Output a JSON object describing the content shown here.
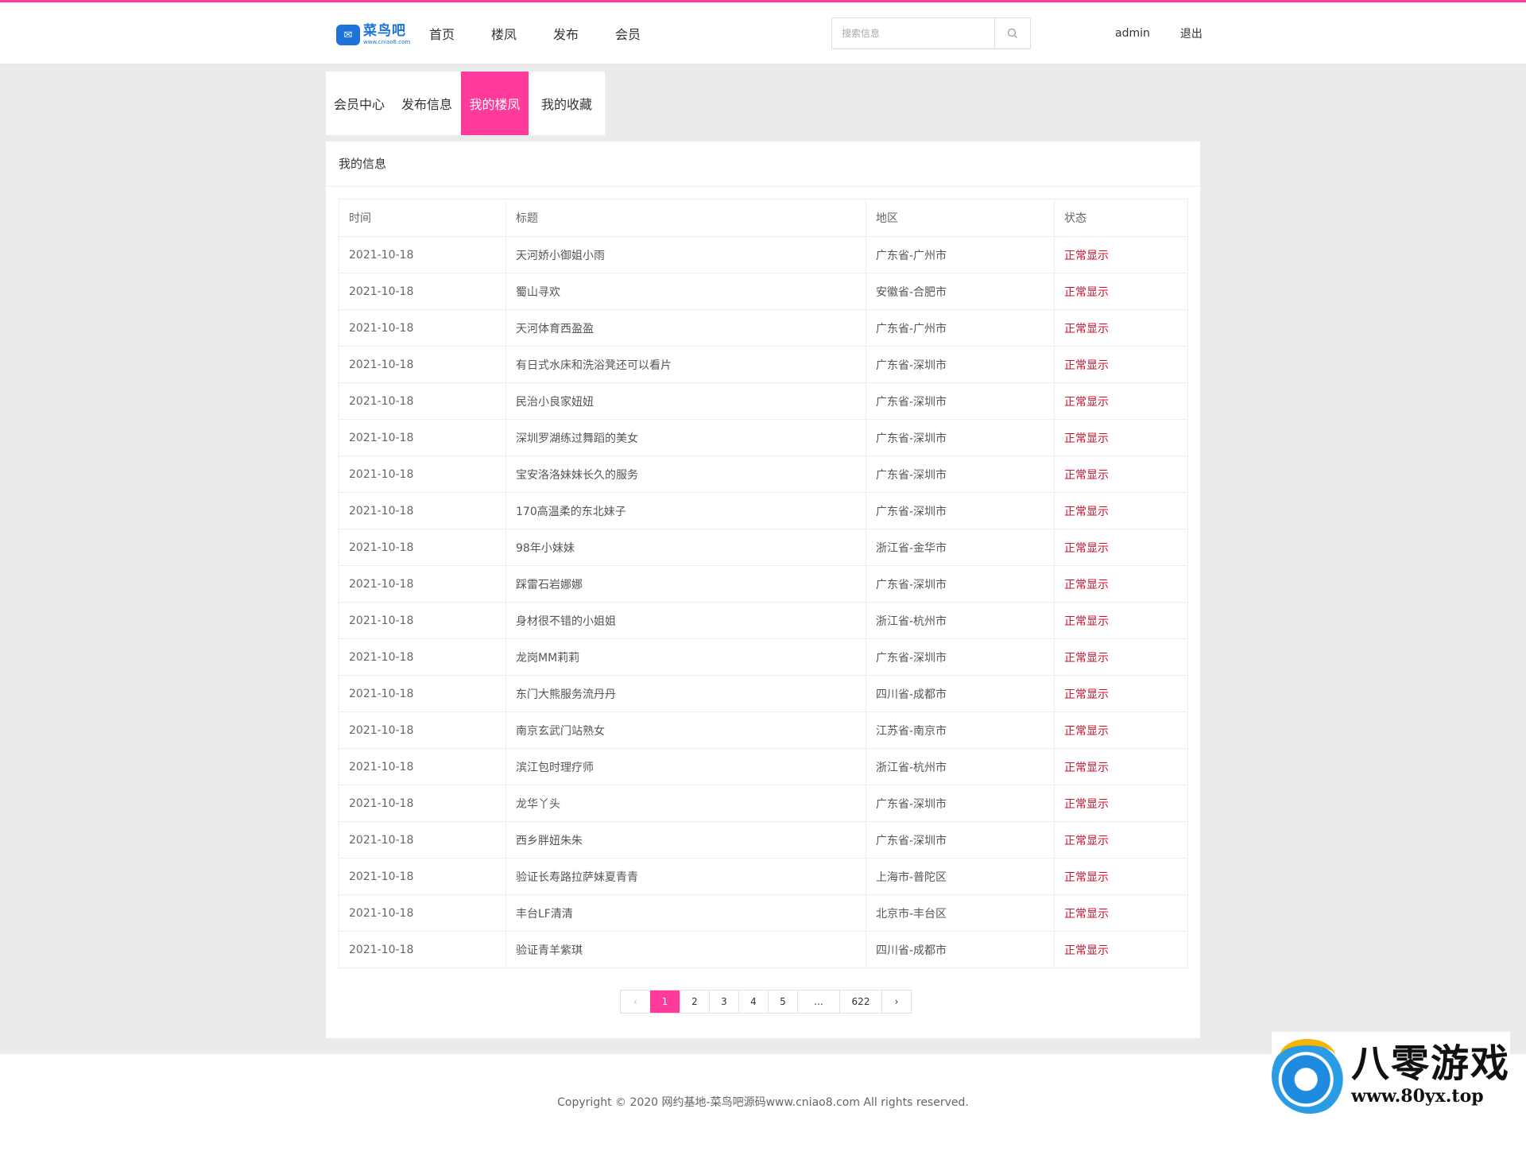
{
  "colors": {
    "accent": "#ff3a9a",
    "status": "#d0112b",
    "logo": "#1e73d9"
  },
  "header": {
    "logo_text": "菜鸟吧",
    "logo_url": "www.cniao8.com",
    "nav": [
      "首页",
      "楼凤",
      "发布",
      "会员"
    ],
    "search_placeholder": "搜索信息",
    "username": "admin",
    "logout": "退出"
  },
  "tabs": [
    {
      "label": "会员中心",
      "active": false
    },
    {
      "label": "发布信息",
      "active": false
    },
    {
      "label": "我的楼凤",
      "active": true
    },
    {
      "label": "我的收藏",
      "active": false
    }
  ],
  "panel": {
    "title": "我的信息",
    "columns": [
      "时间",
      "标题",
      "地区",
      "状态"
    ],
    "rows": [
      [
        "2021-10-18",
        "天河娇小御姐小雨",
        "广东省-广州市",
        "正常显示"
      ],
      [
        "2021-10-18",
        "蜀山寻欢",
        "安徽省-合肥市",
        "正常显示"
      ],
      [
        "2021-10-18",
        "天河体育西盈盈",
        "广东省-广州市",
        "正常显示"
      ],
      [
        "2021-10-18",
        "有日式水床和洗浴凳还可以看片",
        "广东省-深圳市",
        "正常显示"
      ],
      [
        "2021-10-18",
        "民治小良家妞妞",
        "广东省-深圳市",
        "正常显示"
      ],
      [
        "2021-10-18",
        "深圳罗湖练过舞蹈的美女",
        "广东省-深圳市",
        "正常显示"
      ],
      [
        "2021-10-18",
        "宝安洛洛妹妹长久的服务",
        "广东省-深圳市",
        "正常显示"
      ],
      [
        "2021-10-18",
        "170高温柔的东北妹子",
        "广东省-深圳市",
        "正常显示"
      ],
      [
        "2021-10-18",
        "98年小妹妹",
        "浙江省-金华市",
        "正常显示"
      ],
      [
        "2021-10-18",
        "踩雷石岩娜娜",
        "广东省-深圳市",
        "正常显示"
      ],
      [
        "2021-10-18",
        "身材很不错的小姐姐",
        "浙江省-杭州市",
        "正常显示"
      ],
      [
        "2021-10-18",
        "龙岗MM莉莉",
        "广东省-深圳市",
        "正常显示"
      ],
      [
        "2021-10-18",
        "东门大熊服务流丹丹",
        "四川省-成都市",
        "正常显示"
      ],
      [
        "2021-10-18",
        "南京玄武门站熟女",
        "江苏省-南京市",
        "正常显示"
      ],
      [
        "2021-10-18",
        "滨江包时理疗师",
        "浙江省-杭州市",
        "正常显示"
      ],
      [
        "2021-10-18",
        "龙华丫头",
        "广东省-深圳市",
        "正常显示"
      ],
      [
        "2021-10-18",
        "西乡胖妞朱朱",
        "广东省-深圳市",
        "正常显示"
      ],
      [
        "2021-10-18",
        "验证长寿路拉萨妹夏青青",
        "上海市-普陀区",
        "正常显示"
      ],
      [
        "2021-10-18",
        "丰台LF清清",
        "北京市-丰台区",
        "正常显示"
      ],
      [
        "2021-10-18",
        "验证青羊紫琪",
        "四川省-成都市",
        "正常显示"
      ]
    ]
  },
  "pagination": {
    "prev": "‹",
    "pages": [
      "1",
      "2",
      "3",
      "4",
      "5",
      "...",
      "622"
    ],
    "current": "1",
    "next": "›"
  },
  "footer": {
    "copyright": "Copyright © 2020 网约基地-菜鸟吧源码www.cniao8.com All rights reserved."
  },
  "watermark": {
    "text": "八零游戏",
    "url": "www.80yx.top"
  }
}
